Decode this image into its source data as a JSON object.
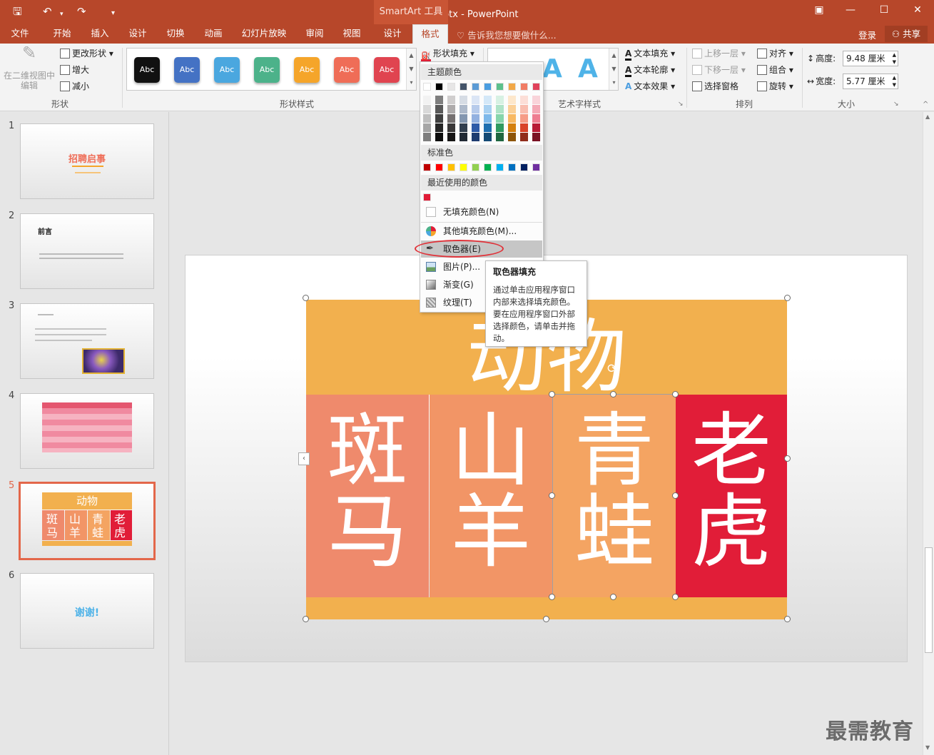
{
  "window": {
    "title": "谢谢.pptx - PowerPoint",
    "context_group": "SmartArt 工具"
  },
  "tabs": [
    "文件",
    "开始",
    "插入",
    "设计",
    "切换",
    "动画",
    "幻灯片放映",
    "审阅",
    "视图",
    "设计",
    "格式"
  ],
  "tellme": "告诉我您想要做什么...",
  "login": "登录",
  "share": "共享",
  "ribbon": {
    "shape_group": {
      "edit_2d": "在二维视图中编辑",
      "change_shape": "更改形状",
      "larger": "增大",
      "smaller": "减小",
      "label": "形状"
    },
    "shape_styles": {
      "label": "形状样式",
      "swatch_text": "Abc",
      "swatches": [
        "#111111",
        "#4472c4",
        "#4aa7df",
        "#4cb28a",
        "#f5a52a",
        "#ef6d57",
        "#e04450"
      ],
      "fill_button": "形状填充"
    },
    "art_styles": {
      "label": "艺术字样式",
      "sample": "A",
      "text_fill": "文本填充",
      "text_outline": "文本轮廓",
      "text_effect": "文本效果"
    },
    "arrange": {
      "label": "排列",
      "bring_forward": "上移一层",
      "send_backward": "下移一层",
      "selection_pane": "选择窗格",
      "align": "对齐",
      "group": "组合",
      "rotate": "旋转"
    },
    "size": {
      "label": "大小",
      "height_label": "高度:",
      "height_value": "9.48 厘米",
      "width_label": "宽度:",
      "width_value": "5.77 厘米"
    }
  },
  "thumbnails": {
    "numbers": [
      "1",
      "2",
      "3",
      "4",
      "5",
      "6"
    ],
    "slide1_title": "招聘启事",
    "slide2_title": "前言",
    "slide5_title": "动物",
    "slide5_cells": [
      "斑马",
      "山羊",
      "青蛙",
      "老虎"
    ],
    "slide6_title": "谢谢!"
  },
  "slide": {
    "title": "动物",
    "cells": [
      {
        "top": "斑",
        "bottom": "马",
        "color": "#ef8a6c"
      },
      {
        "top": "山",
        "bottom": "羊",
        "color": "#f29566"
      },
      {
        "top": "青",
        "bottom": "蛙",
        "color": "#f4a462"
      },
      {
        "top": "老",
        "bottom": "虎",
        "color": "#e11d38"
      }
    ],
    "header_color": "#f2b04e"
  },
  "fill_menu": {
    "theme_header": "主题颜色",
    "standard_header": "标准色",
    "recent_header": "最近使用的颜色",
    "theme_top": [
      "#ffffff",
      "#000000",
      "#e7e6e6",
      "#44546a",
      "#5b9bd5",
      "#4a9de0",
      "#5cc08c",
      "#f2a847",
      "#f07c65",
      "#e0425b"
    ],
    "theme_shades": [
      [
        "#f2f2f2",
        "#7f7f7f",
        "#d0cece",
        "#d6dce4",
        "#dbe5f5",
        "#d4e8f8",
        "#d7f1e3",
        "#fde7cb",
        "#fcded7",
        "#f9d4da"
      ],
      [
        "#d9d9d9",
        "#595959",
        "#aeabab",
        "#adb9ca",
        "#b7cbeb",
        "#a9d1f1",
        "#afe3c7",
        "#fbd097",
        "#f9bdaf",
        "#f4a9b6"
      ],
      [
        "#bfbfbf",
        "#3f3f3f",
        "#757070",
        "#8497b0",
        "#93b1e0",
        "#7eb9ea",
        "#87d5ab",
        "#f8b963",
        "#f69c87",
        "#ee7d91"
      ],
      [
        "#a6a6a6",
        "#262626",
        "#3a3838",
        "#323f4f",
        "#2e5ba8",
        "#1e6fb0",
        "#2f9a5f",
        "#d4800f",
        "#d9432a",
        "#b81b36"
      ],
      [
        "#7f7f7f",
        "#0d0d0d",
        "#171616",
        "#222a35",
        "#1e3c70",
        "#144a75",
        "#1f6640",
        "#8d550a",
        "#912d1c",
        "#7a1224"
      ]
    ],
    "standard": [
      "#c00000",
      "#ff0000",
      "#ffc000",
      "#ffff00",
      "#92d050",
      "#00b050",
      "#00b0f0",
      "#0070c0",
      "#002060",
      "#7030a0"
    ],
    "recent": [
      "#e11d38"
    ],
    "no_fill": "无填充颜色(N)",
    "more_colors": "其他填充颜色(M)...",
    "eyedropper": "取色器(E)",
    "picture": "图片(P)...",
    "gradient": "渐变(G)",
    "texture": "纹理(T)"
  },
  "tooltip": {
    "title": "取色器填充",
    "body": "通过单击应用程序窗口内部来选择填充颜色。要在应用程序窗口外部选择颜色，请单击并拖动。"
  },
  "watermark": "最需教育"
}
